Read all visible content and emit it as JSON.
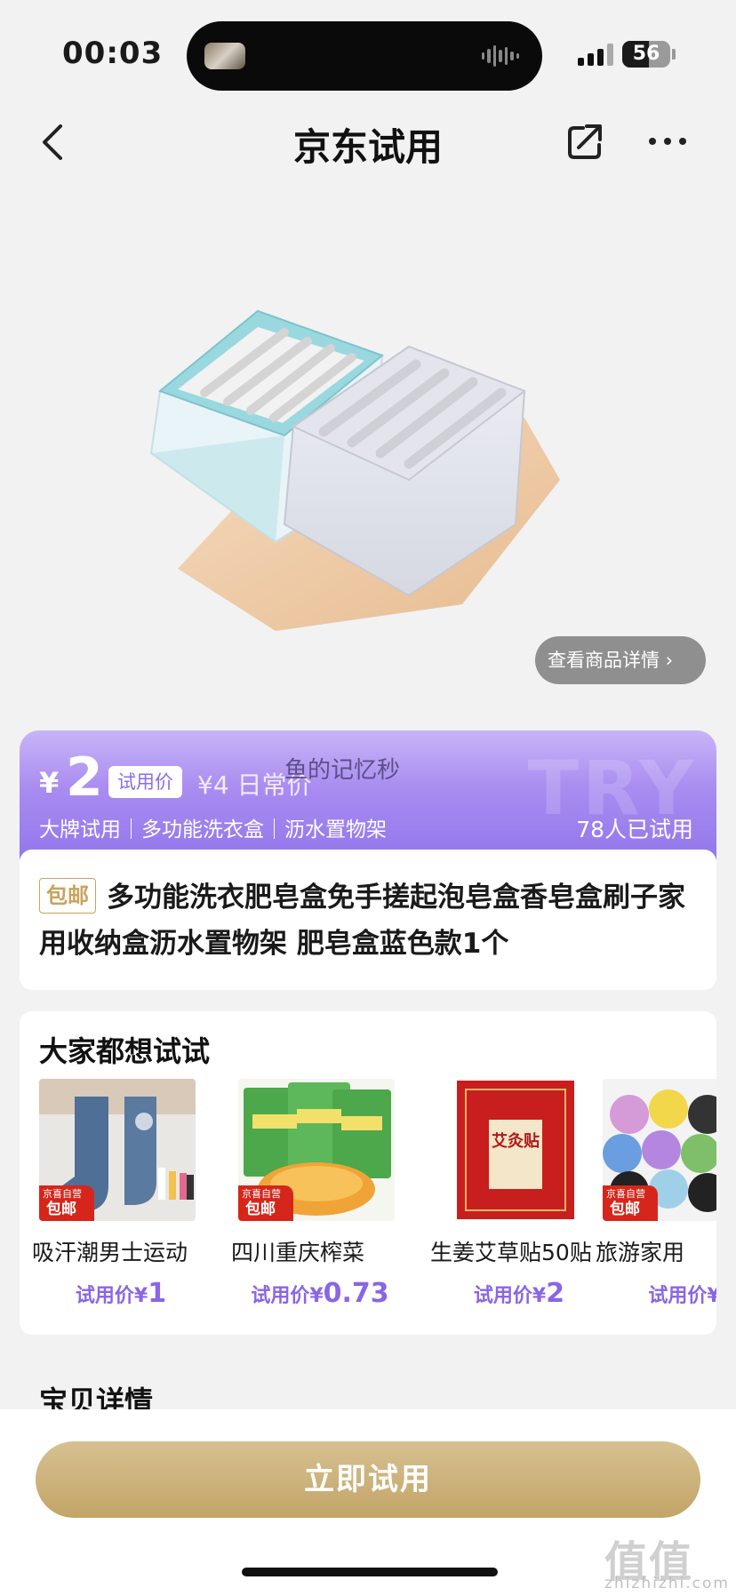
{
  "status_bar": {
    "time": "00:03",
    "battery": "56",
    "battery_level": 0.56
  },
  "nav": {
    "title": "京东试用"
  },
  "hero": {
    "detail_button": "查看商品详情"
  },
  "price_banner": {
    "currency": "¥",
    "price": "2",
    "trial_tag": "试用价",
    "original_price": "¥4 日常价",
    "author_watermark": "鱼的记忆秒",
    "background_watermark": "TRY",
    "tags": "大牌试用｜多功能洗衣盒｜沥水置物架",
    "tried_count": "78人已试用"
  },
  "product": {
    "free_shipping": "包邮",
    "title": "多功能洗衣肥皂盒免手搓起泡皂盒香皂盒刷子家用收纳盒沥水置物架 肥皂盒蓝色款1个"
  },
  "recommend": {
    "heading": "大家都想试试",
    "badge_top": "京喜自营",
    "badge_bottom": "包邮",
    "items": [
      {
        "name": "吸汗潮男士运动",
        "price_label": "试用价¥",
        "price": "1",
        "icon": "socks-image"
      },
      {
        "name": "四川重庆榨菜",
        "price_label": "试用价¥",
        "price": "0.73",
        "icon": "pickle-image"
      },
      {
        "name": "生姜艾草贴50贴",
        "price_label": "试用价¥",
        "price": "2",
        "icon": "moxa-patch-image",
        "pack_text": "艾灸贴"
      },
      {
        "name": "旅游家用",
        "price_label": "试用价¥",
        "price": "",
        "icon": "trash-bag-image"
      }
    ]
  },
  "details_peek": "宝贝详情",
  "bottom": {
    "cta": "立即试用",
    "site_logo": "值值值",
    "site_url": "zhizhizhi.com"
  },
  "colors": {
    "accent": "#9277ec",
    "gold": "#c9a35c",
    "price_purple": "#8a66e3",
    "badge_red": "#d6261b"
  }
}
